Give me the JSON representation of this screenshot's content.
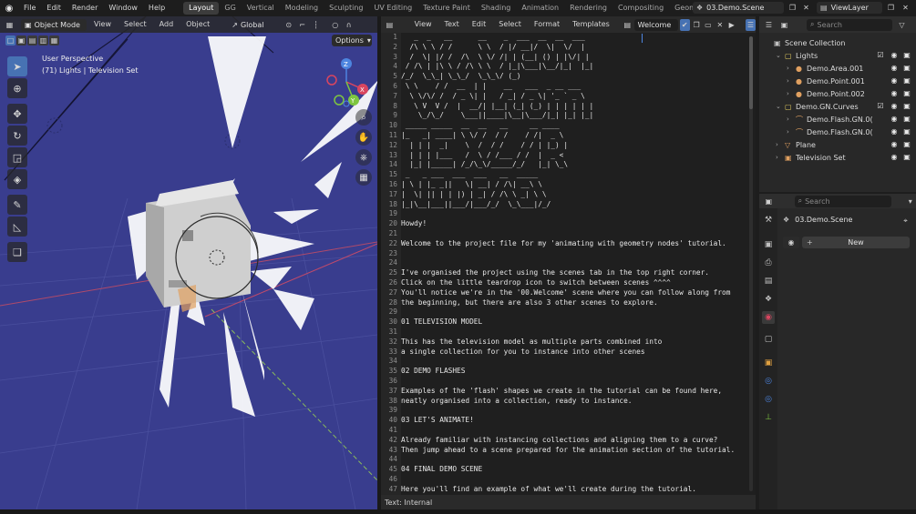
{
  "topbar": {
    "menus": [
      "File",
      "Edit",
      "Render",
      "Window",
      "Help"
    ],
    "workspaces": [
      "Layout",
      "GG",
      "Vertical",
      "Modeling",
      "Sculpting",
      "UV Editing",
      "Texture Paint",
      "Shading",
      "Animation",
      "Rendering",
      "Compositing",
      "Geometry Node"
    ],
    "active_workspace": "Layout",
    "scene_name": "03.Demo.Scene",
    "view_layer": "ViewLayer"
  },
  "viewport": {
    "mode": "Object Mode",
    "menus": [
      "View",
      "Select",
      "Add",
      "Object"
    ],
    "transform_orientation": "Global",
    "options_label": "Options",
    "perspective_label": "User Perspective",
    "object_info": "(71) Lights | Television Set",
    "gizmo_axes": {
      "x": "X",
      "y": "Y",
      "z": "Z"
    },
    "colors": {
      "background": "#393d8e",
      "x_axis": "#d9455f",
      "y_axis": "#7ec540",
      "z_axis": "#4d85e0",
      "active_tool": "#4772b3"
    }
  },
  "editor": {
    "menus": [
      "View",
      "Text",
      "Edit",
      "Select",
      "Format",
      "Templates"
    ],
    "text_name": "Welcome",
    "footer": "Text: Internal",
    "lines": [
      "   _  _   __      __    _  ___  __  __  ___ ",
      "  /\\ \\ \\ / /      \\ \\  / |/ __|/  \\|  \\/  |",
      "  /  \\| |/ /  /\\  \\ \\/ /| | (__| () | |\\/| |",
      " / /\\ | |\\ \\ / /\\ \\ \\  / |_|\\___|\\__/|_|  |_|",
      "/_/  \\_\\_| \\_\\_/  \\_\\_\\/ (_)                  ",
      " \\ \\    / /  __  | |    __   ___  _ __ ___  ",
      "  \\ \\/\\/ /  / _ \\| |   / _| / _ \\| '_ ` _ \\ ",
      "   \\ V  V /  |  __/| |__| (_| (_) | | | | | |",
      "    \\_/\\_/    \\___||____|\\__|\\___/|_| |_| |_|",
      " _____ _____  __  __   __     __ ____  ",
      "|_   _| ____| \\ \\/ /  / /    / /|  _ \\ ",
      "  | | |  _|    \\  /  / /    / / | |_) |",
      "  | | | |___   /  \\ / /___ / /  |  _ < ",
      "  |_| |_____| /_/\\_\\/_____/_/   |_| \\_\\",
      " _   _ ___  ___  ___   __  _____ ",
      "| \\ | |_ _||   \\| __| / /\\| __\\ \\",
      "|  \\| || | | |) | _| / /\\ \\ _| \\ \\",
      "|_|\\__|___||___/|___/_/  \\_\\___|/_/",
      "",
      "Howdy!",
      "",
      "Welcome to the project file for my 'animating with geometry nodes' tutorial.",
      "",
      "",
      "I've organised the project using the scenes tab in the top right corner.",
      "Click on the little teardrop icon to switch between scenes ^^^^",
      "You'll notice we're in the '00.Welcome' scene where you can follow along from",
      "the beginning, but there are also 3 other scenes to explore.",
      "",
      "01 TELEVISION MODEL",
      "",
      "This has the television model as multiple parts combined into",
      "a single collection for you to instance into other scenes",
      "",
      "02 DEMO FLASHES",
      "",
      "Examples of the 'flash' shapes we create in the tutorial can be found here,",
      "neatly organised into a collection, ready to instance.",
      "",
      "03 LET'S ANIMATE!",
      "",
      "Already familiar with instancing collections and aligning them to a curve?",
      "Then jump ahead to a scene prepared for the animation section of the tutorial.",
      "",
      "04 FINAL DEMO SCENE",
      "",
      "Here you'll find an example of what we'll create during the tutorial."
    ]
  },
  "outliner": {
    "search_placeholder": "Search",
    "rows": [
      {
        "label": "Scene Collection",
        "depth": 0,
        "kind": "scene"
      },
      {
        "label": "Lights",
        "depth": 1,
        "kind": "collection"
      },
      {
        "label": "Demo.Area.001",
        "depth": 2,
        "kind": "light"
      },
      {
        "label": "Demo.Point.001",
        "depth": 2,
        "kind": "light"
      },
      {
        "label": "Demo.Point.002",
        "depth": 2,
        "kind": "light"
      },
      {
        "label": "Demo.GN.Curves",
        "depth": 1,
        "kind": "collection"
      },
      {
        "label": "Demo.Flash.GN.0(",
        "depth": 2,
        "kind": "curve"
      },
      {
        "label": "Demo.Flash.GN.0(",
        "depth": 2,
        "kind": "curve"
      },
      {
        "label": "Plane",
        "depth": 1,
        "kind": "mesh"
      },
      {
        "label": "Television Set",
        "depth": 1,
        "kind": "instance"
      }
    ]
  },
  "properties": {
    "search_placeholder": "Search",
    "scene_name": "03.Demo.Scene",
    "new_label": "New"
  }
}
